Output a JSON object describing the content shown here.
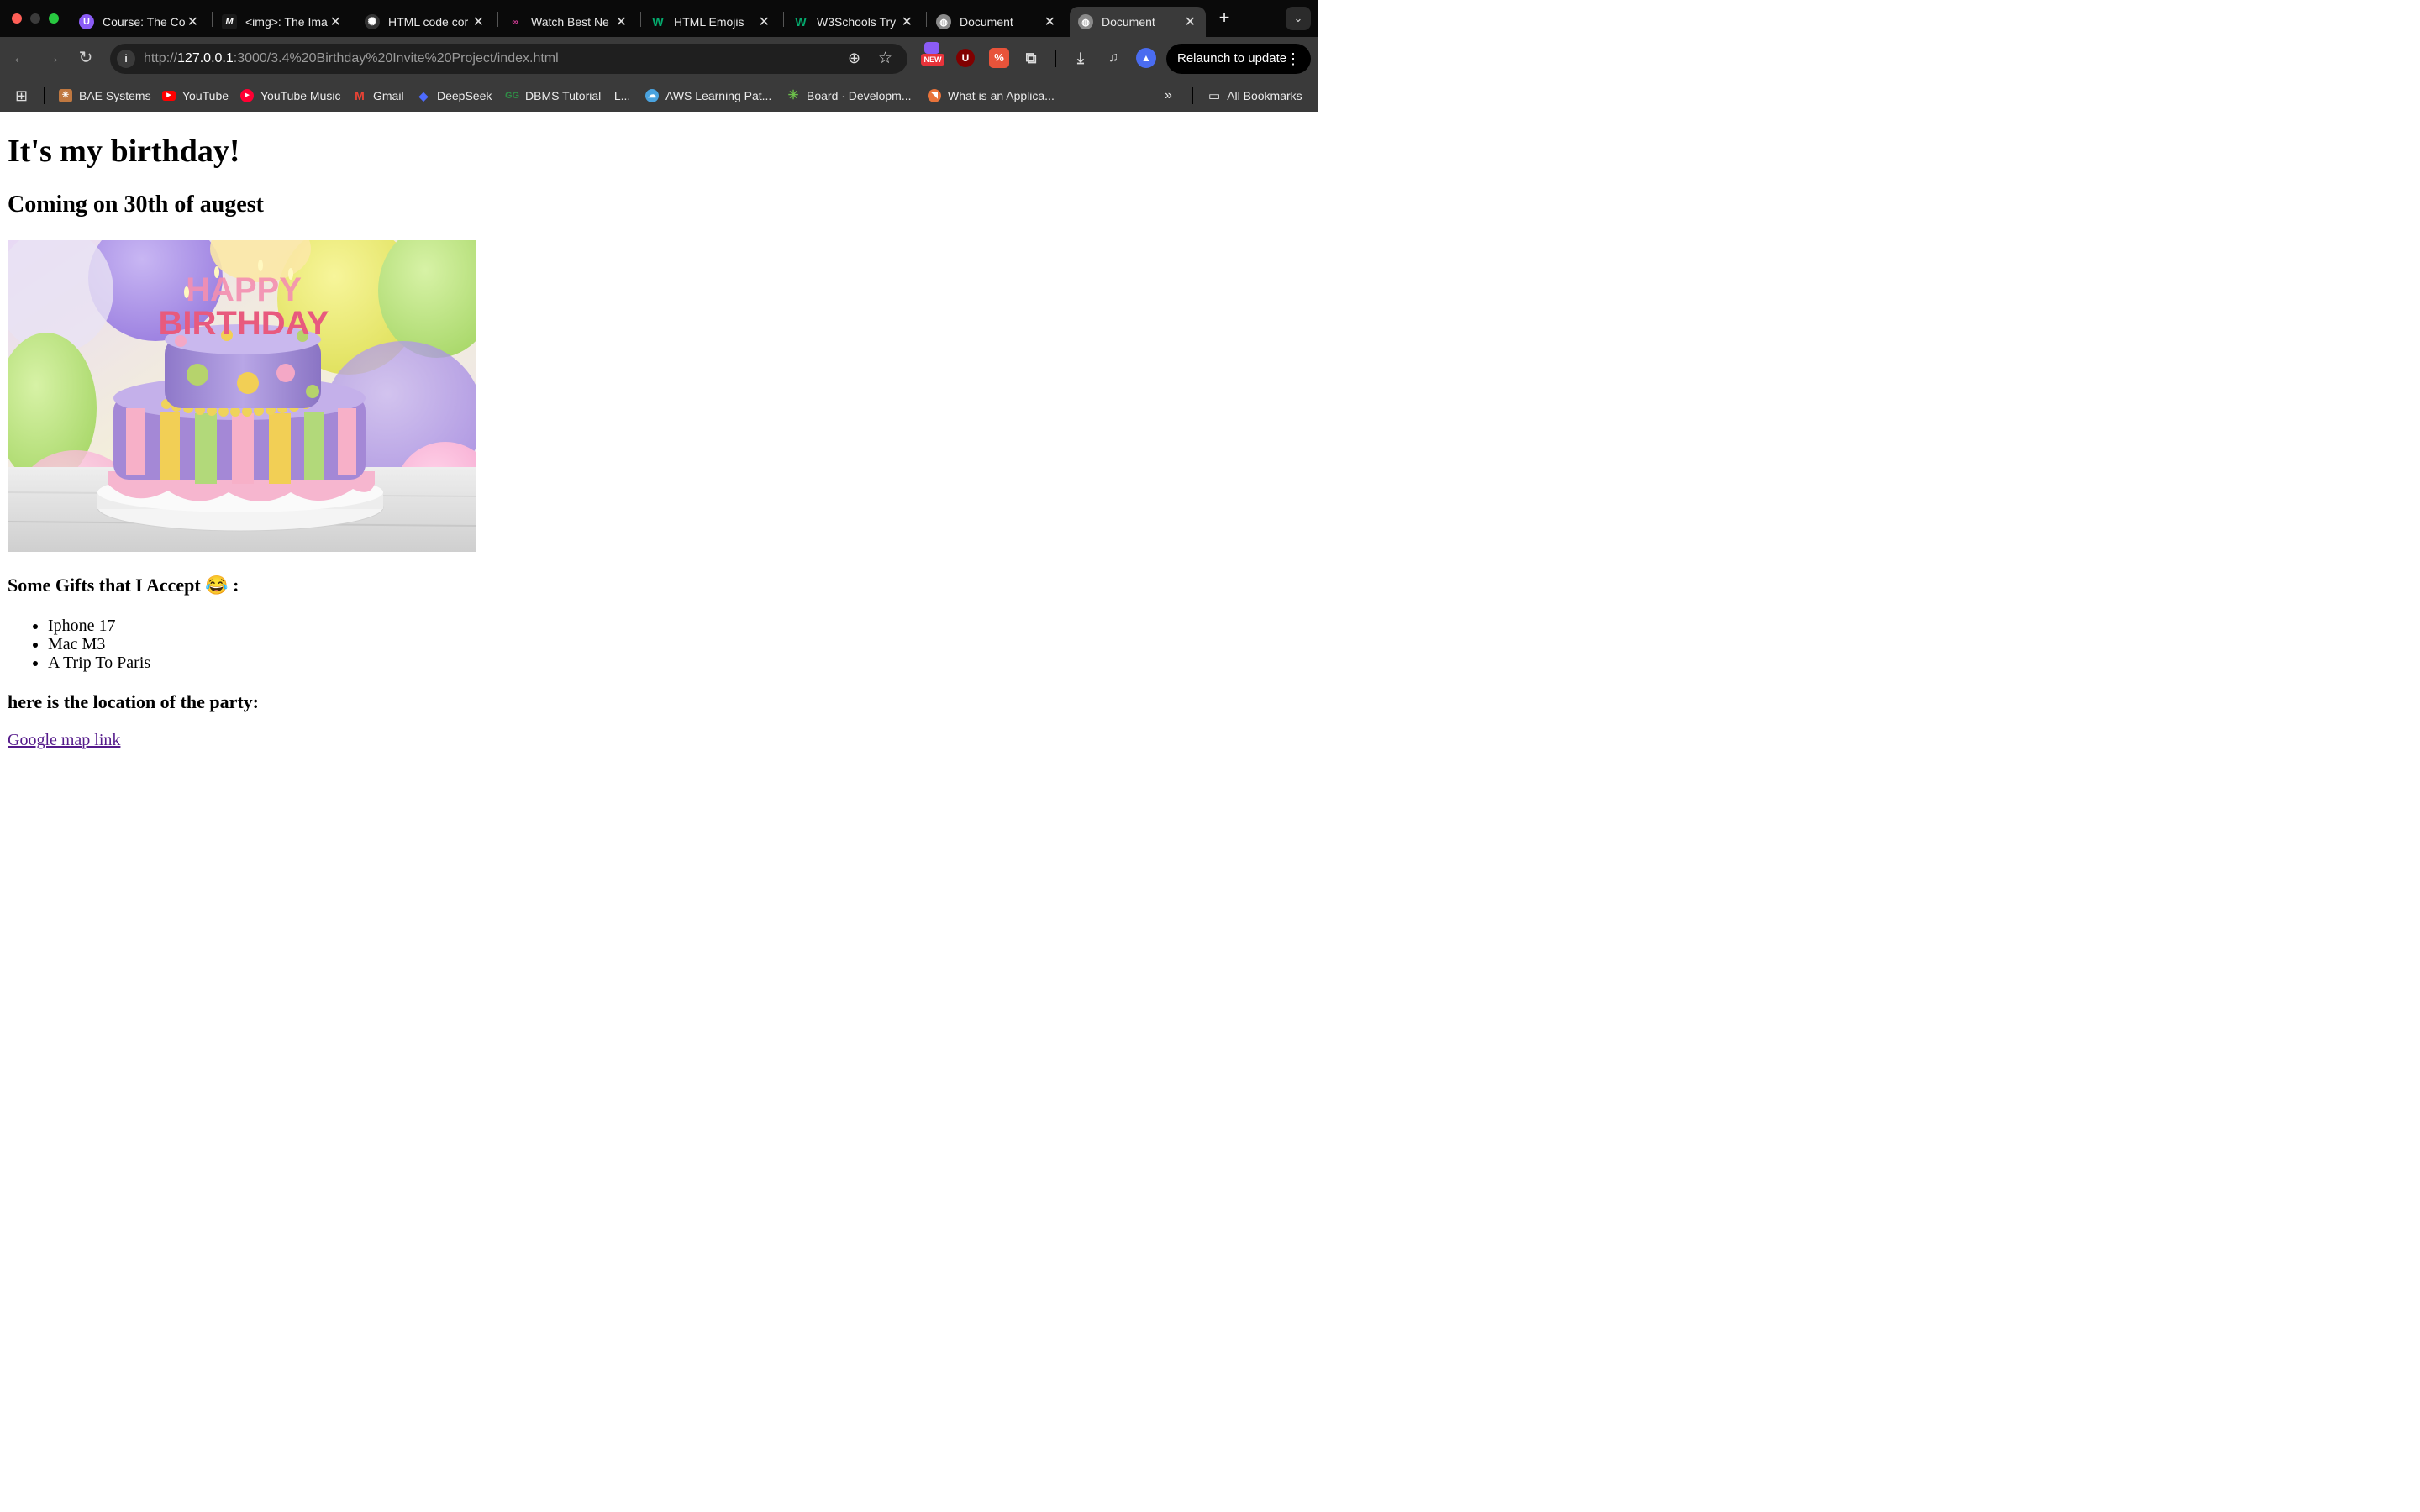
{
  "browser": {
    "tabs": [
      {
        "label": "Course: The Co",
        "favicon": "udemy-icon",
        "color": "#8b5cf6"
      },
      {
        "label": "<img>: The Ima",
        "favicon": "mdn-icon",
        "color": "#1a1a1a"
      },
      {
        "label": "HTML code cor",
        "favicon": "chatgpt-icon",
        "color": "#333333"
      },
      {
        "label": "Watch Best Ne",
        "favicon": "streaming-icon",
        "color": "#e040a0"
      },
      {
        "label": "HTML Emojis",
        "favicon": "w3schools-icon",
        "color": "#04aa6d"
      },
      {
        "label": "W3Schools Try",
        "favicon": "w3schools-icon",
        "color": "#04aa6d"
      },
      {
        "label": "Document",
        "favicon": "globe-icon",
        "color": "#8a8a8a"
      },
      {
        "label": "Document",
        "favicon": "globe-icon",
        "color": "#8a8a8a"
      }
    ],
    "active_tab_index": 7,
    "url": {
      "scheme": "http://",
      "host": "127.0.0.1",
      "rest": ":3000/3.4%20Birthday%20Invite%20Project/index.html"
    },
    "new_badge": "NEW",
    "relaunch_label": "Relaunch to update",
    "bookmarks": [
      {
        "label": "BAE Systems",
        "icon": "bae-icon",
        "color": "#c07840"
      },
      {
        "label": "YouTube",
        "icon": "youtube-icon",
        "color": "#ff0000"
      },
      {
        "label": "YouTube Music",
        "icon": "youtube-music-icon",
        "color": "#ff0033"
      },
      {
        "label": "Gmail",
        "icon": "gmail-icon",
        "color": "#ea4335"
      },
      {
        "label": "DeepSeek",
        "icon": "deepseek-icon",
        "color": "#4d6bfe"
      },
      {
        "label": "DBMS Tutorial – L...",
        "icon": "geeksforgeeks-icon",
        "color": "#2f8d46"
      },
      {
        "label": "AWS Learning Pat...",
        "icon": "aws-icon",
        "color": "#4aa3df"
      },
      {
        "label": "Board · Developm...",
        "icon": "board-icon",
        "color": "#6cc04a"
      },
      {
        "label": "What is an Applica...",
        "icon": "application-icon",
        "color": "#e8733a"
      }
    ],
    "all_bookmarks_label": "All Bookmarks"
  },
  "page": {
    "title": "It's my birthday!",
    "subtitle": "Coming on 30th of augest",
    "cake_text_top": "HAPPY",
    "cake_text_bottom": "BIRTHDAY",
    "gifts_heading": "Some Gifts that I Accept 😂 :",
    "gifts": [
      "Iphone 17",
      "Mac M3",
      "A Trip To Paris"
    ],
    "location_heading": "here is the location of the party:",
    "map_link": "Google map link"
  }
}
